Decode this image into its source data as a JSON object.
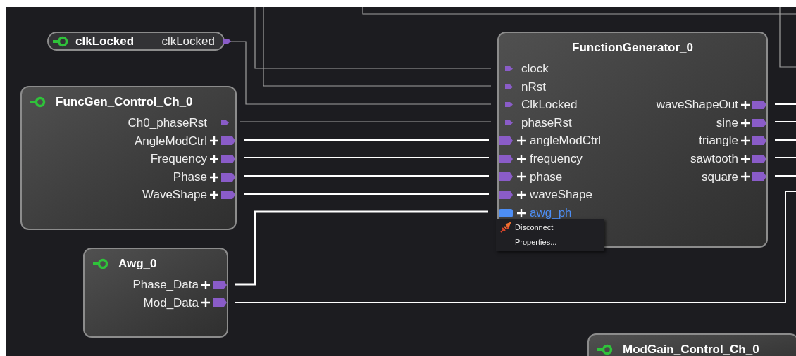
{
  "diagram": {
    "blocks": [
      {
        "kind": "pill",
        "title": "clkLocked",
        "outputs": [
          {
            "label": "clkLocked",
            "kind": "single",
            "selected": false
          }
        ]
      },
      {
        "kind": "block",
        "title": "FuncGen_Control_Ch_0",
        "outputs": [
          {
            "label": "Ch0_phaseRst",
            "kind": "single",
            "selected": false
          },
          {
            "label": "AngleModCtrl",
            "kind": "bus",
            "selected": false
          },
          {
            "label": "Frequency",
            "kind": "bus",
            "selected": false
          },
          {
            "label": "Phase",
            "kind": "bus",
            "selected": false
          },
          {
            "label": "WaveShape",
            "kind": "bus",
            "selected": false
          }
        ]
      },
      {
        "kind": "block",
        "title": "FunctionGenerator_0",
        "inputs": [
          {
            "label": "clock",
            "kind": "single",
            "selected": false
          },
          {
            "label": "nRst",
            "kind": "single",
            "selected": false
          },
          {
            "label": "ClkLocked",
            "kind": "single",
            "selected": false
          },
          {
            "label": "phaseRst",
            "kind": "single",
            "selected": false
          },
          {
            "label": "angleModCtrl",
            "kind": "bus",
            "selected": false
          },
          {
            "label": "frequency",
            "kind": "bus",
            "selected": false
          },
          {
            "label": "phase",
            "kind": "bus",
            "selected": false
          },
          {
            "label": "waveShape",
            "kind": "bus",
            "selected": false
          },
          {
            "label": "awg_ph",
            "kind": "bus",
            "selected": true
          }
        ],
        "outputs": [
          {
            "label": "waveShapeOut",
            "kind": "bus",
            "selected": false
          },
          {
            "label": "sine",
            "kind": "bus",
            "selected": false
          },
          {
            "label": "triangle",
            "kind": "bus",
            "selected": false
          },
          {
            "label": "sawtooth",
            "kind": "bus",
            "selected": false
          },
          {
            "label": "square",
            "kind": "bus",
            "selected": false
          }
        ]
      },
      {
        "kind": "block",
        "title": "Awg_0",
        "outputs": [
          {
            "label": "Phase_Data",
            "kind": "bus",
            "selected": false
          },
          {
            "label": "Mod_Data",
            "kind": "bus",
            "selected": false
          }
        ]
      },
      {
        "kind": "block",
        "title": "ModGain_Control_Ch_0"
      }
    ]
  },
  "context_menu": {
    "items": [
      {
        "label": "Disconnect",
        "kind": "disconnect"
      },
      {
        "label": "Properties...",
        "kind": "plain"
      }
    ]
  }
}
